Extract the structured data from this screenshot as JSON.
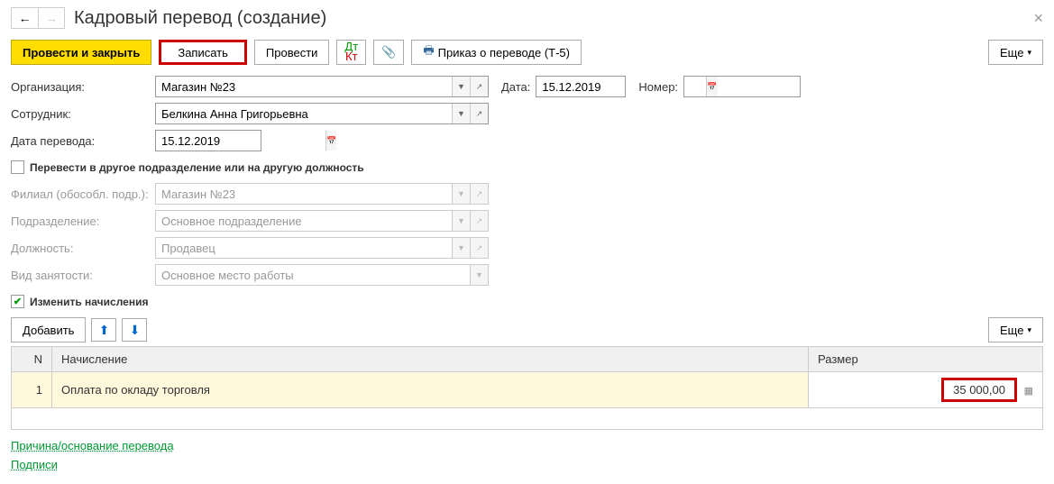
{
  "header": {
    "title": "Кадровый перевод (создание)"
  },
  "toolbar": {
    "post_and_close": "Провести и закрыть",
    "record": "Записать",
    "post": "Провести",
    "print_order": "Приказ о переводе (Т-5)",
    "more": "Еще"
  },
  "form": {
    "org_label": "Организация:",
    "org_value": "Магазин №23",
    "employee_label": "Сотрудник:",
    "employee_value": "Белкина Анна Григорьевна",
    "transfer_date_label": "Дата перевода:",
    "transfer_date_value": "15.12.2019",
    "date_label": "Дата:",
    "date_value": "15.12.2019",
    "number_label": "Номер:",
    "number_value": "",
    "checkbox_transfer": "Перевести в другое подразделение или на другую должность",
    "branch_label": "Филиал (обособл. подр.):",
    "branch_value": "Магазин №23",
    "dept_label": "Подразделение:",
    "dept_value": "Основное подразделение",
    "position_label": "Должность:",
    "position_value": "Продавец",
    "employment_label": "Вид занятости:",
    "employment_value": "Основное место работы",
    "checkbox_accrual": "Изменить начисления"
  },
  "table": {
    "add": "Добавить",
    "more": "Еще",
    "col_n": "N",
    "col_accrual": "Начисление",
    "col_size": "Размер",
    "rows": [
      {
        "n": "1",
        "accrual": "Оплата по окладу торговля",
        "size": "35 000,00"
      }
    ]
  },
  "links": {
    "reason": "Причина/основание перевода",
    "signatures": "Подписи"
  }
}
